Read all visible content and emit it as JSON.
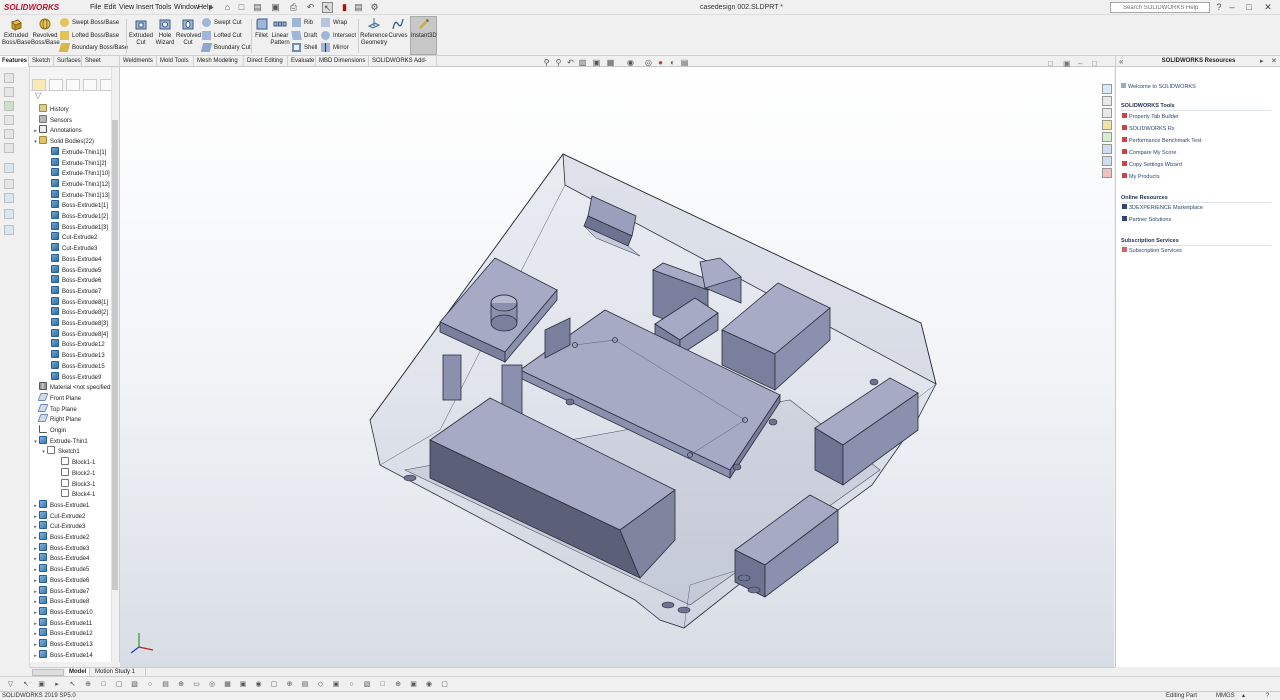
{
  "app": {
    "logo_text": "SOLIDWORKS",
    "document_title": "casedesign 002.SLDPRT *"
  },
  "menu": [
    "File",
    "Edit",
    "View",
    "Insert",
    "Tools",
    "Window",
    "Help"
  ],
  "search": {
    "placeholder": "Search SOLIDWORKS Help"
  },
  "ribbon": {
    "extruded_boss": "Extruded Boss/Base",
    "revolved_boss": "Revolved Boss/Base",
    "swept_boss": "Swept Boss/Base",
    "lofted_boss": "Lofted Boss/Base",
    "boundary_boss": "Boundary Boss/Base",
    "extruded_cut": "Extruded Cut",
    "hole_wizard": "Hole Wizard",
    "revolved_cut": "Revolved Cut",
    "swept_cut": "Swept Cut",
    "lofted_cut": "Lofted Cut",
    "boundary_cut": "Boundary Cut",
    "fillet": "Fillet",
    "linear_pattern": "Linear Pattern",
    "rib": "Rib",
    "draft": "Draft",
    "shell": "Shell",
    "wrap": "Wrap",
    "intersect": "Intersect",
    "mirror": "Mirror",
    "reference_geometry": "Reference Geometry",
    "curves": "Curves",
    "instant3d": "Instant3D"
  },
  "command_tabs": [
    "Features",
    "Sketch",
    "Surfaces",
    "Sheet Metal",
    "Weldments",
    "Mold Tools",
    "Mesh Modeling",
    "Direct Editing",
    "Evaluate",
    "MBD Dimensions",
    "SOLIDWORKS Add-Ins"
  ],
  "tree": {
    "history": "History",
    "sensors": "Sensors",
    "annotations": "Annotations",
    "solid_bodies": "Solid Bodies(22)",
    "bodies": [
      "Extrude-Thin1[1]",
      "Extrude-Thin1[2]",
      "Extrude-Thin1[10]",
      "Extrude-Thin1[12]",
      "Extrude-Thin1[13]",
      "Boss-Extrude1[1]",
      "Boss-Extrude1[2]",
      "Boss-Extrude1[3]",
      "Cut-Extrude2",
      "Cut-Extrude3",
      "Boss-Extrude4",
      "Boss-Extrude5",
      "Boss-Extrude6",
      "Boss-Extrude7",
      "Boss-Extrude8[1]",
      "Boss-Extrude8[2]",
      "Boss-Extrude8[3]",
      "Boss-Extrude8[4]",
      "Boss-Extrude12",
      "Boss-Extrude13",
      "Boss-Extrude15",
      "Boss-Extrude9"
    ],
    "material": "Material <not specified>",
    "front_plane": "Front Plane",
    "top_plane": "Top Plane",
    "right_plane": "Right Plane",
    "origin": "Origin",
    "extrude_thin1": "Extrude-Thin1",
    "sketch1": "Sketch1",
    "blocks": [
      "Block1-1",
      "Block2-1",
      "Block3-1",
      "Block4-1"
    ],
    "features": [
      "Boss-Extrude1",
      "Cut-Extrude2",
      "Cut-Extrude3",
      "Boss-Extrude2",
      "Boss-Extrude3",
      "Boss-Extrude4",
      "Boss-Extrude5",
      "Boss-Extrude6",
      "Boss-Extrude7",
      "Boss-Extrude8",
      "Boss-Extrude10",
      "Boss-Extrude11",
      "Boss-Extrude12",
      "Boss-Extrude13",
      "Boss-Extrude14"
    ]
  },
  "task_pane": {
    "title": "SOLIDWORKS Resources",
    "welcome": "Welcome to SOLIDWORKS",
    "tools_header": "SOLIDWORKS Tools",
    "tools": [
      "Property Tab Builder",
      "SOLIDWORKS Rx",
      "Performance Benchmark Test",
      "Compare My Score",
      "Copy Settings Wizard",
      "My Products"
    ],
    "online_header": "Online Resources",
    "online": [
      "3DEXPERIENCE Marketplace",
      "Partner Solutions"
    ],
    "subscription_header": "Subscription Services",
    "subscription": [
      "Subscription Services"
    ]
  },
  "bottom_tabs": [
    "Model",
    "Motion Study 1"
  ],
  "status": {
    "version": "SOLIDWORKS 2019 SP5.0",
    "mode": "Editing Part",
    "units": "MMGS"
  },
  "colors": {
    "model_face": "#8e94b3",
    "model_edge": "#2a2d3a",
    "logo_red": "#c8102e",
    "accent": "#2a5e93"
  }
}
